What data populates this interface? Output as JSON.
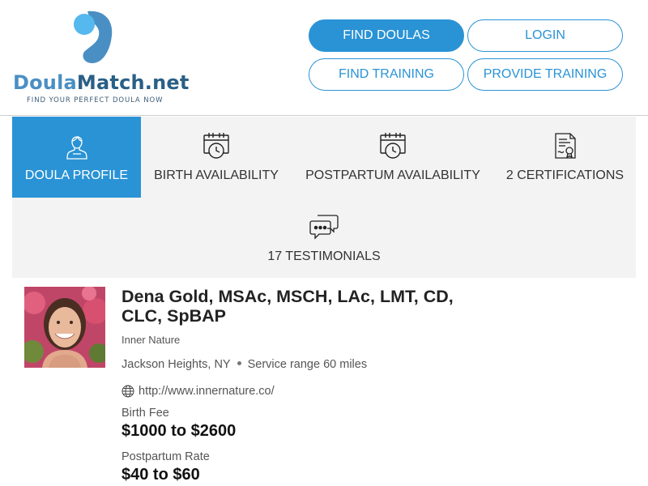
{
  "logo": {
    "word_part1": "Doula",
    "word_part2": "Match.net",
    "tagline": "FIND YOUR PERFECT DOULA NOW",
    "colors": {
      "primary": "#4a8fc4",
      "dark": "#2a5f86",
      "light": "#55b8ee"
    }
  },
  "nav": {
    "find_doulas": "FIND DOULAS",
    "login": "LOGIN",
    "find_training": "FIND TRAINING",
    "provide_training": "PROVIDE TRAINING"
  },
  "tabs": [
    {
      "label": "DOULA PROFILE",
      "icon": "doula-person-icon",
      "active": true
    },
    {
      "label": "BIRTH AVAILABILITY",
      "icon": "calendar-clock-icon",
      "active": false
    },
    {
      "label": "POSTPARTUM AVAILABILITY",
      "icon": "calendar-clock-icon",
      "active": false
    },
    {
      "label": "2 CERTIFICATIONS",
      "icon": "certificate-icon",
      "active": false
    },
    {
      "label": "17 TESTIMONIALS",
      "icon": "chat-bubbles-icon",
      "active": false
    }
  ],
  "profile": {
    "name": "Dena Gold, MSAc, MSCH, LAc, LMT, CD, CLC, SpBAP",
    "organization": "Inner Nature",
    "location": "Jackson Heights, NY",
    "service_range": "Service range 60 miles",
    "website": "http://www.innernature.co/",
    "birth_fee_label": "Birth Fee",
    "birth_fee": "$1000 to $2600",
    "postpartum_label": "Postpartum Rate",
    "postpartum_rate": "$40 to $60"
  },
  "accent_color": "#2a93d5"
}
